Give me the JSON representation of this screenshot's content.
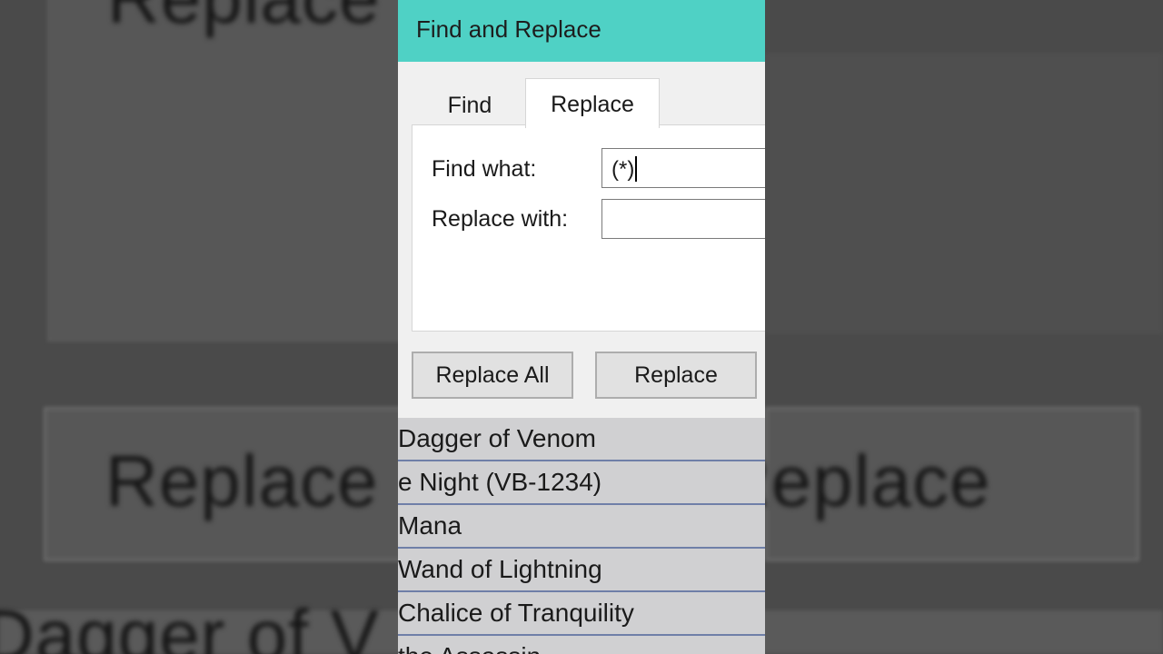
{
  "background": {
    "ghost_top": "Replace",
    "ghost_left": "Replace",
    "ghost_right": "Replace",
    "ghost_bottom": "Dagger of V"
  },
  "dialog": {
    "title": "Find and Replace",
    "tabs": {
      "find": "Find",
      "replace": "Replace"
    },
    "find_what_label": "Find what:",
    "find_what_value": "(*)",
    "replace_with_label": "Replace with:",
    "replace_with_value": "",
    "buttons": {
      "replace_all": "Replace All",
      "replace": "Replace"
    },
    "accent_color": "#4fd1c5"
  },
  "list": {
    "rows": [
      "Dagger of Venom",
      "e Night (VB-1234)",
      "Mana",
      "Wand of Lightning",
      "Chalice of Tranquility",
      "the Assassin"
    ]
  }
}
